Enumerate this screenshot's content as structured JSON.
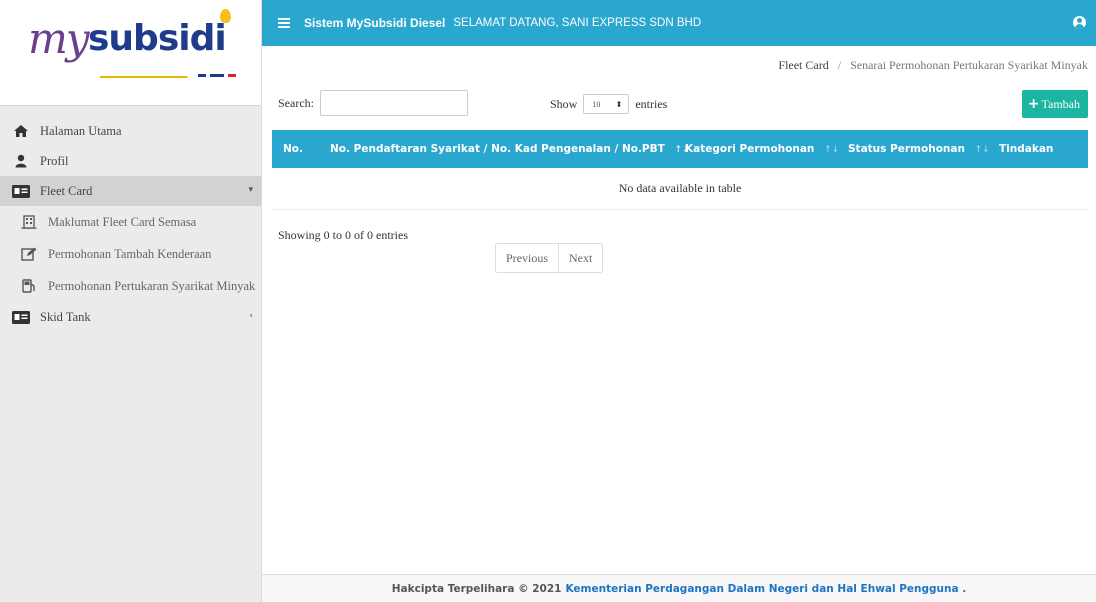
{
  "brand": {
    "logo_my": "my",
    "logo_subsidi": "subsidi"
  },
  "topbar": {
    "system_title": "Sistem MySubsidi Diesel",
    "welcome": "SELAMAT DATANG, SANI EXPRESS SDN BHD"
  },
  "sidebar": {
    "items": [
      {
        "label": "Halaman Utama",
        "icon": "home-icon"
      },
      {
        "label": "Profil",
        "icon": "user-icon"
      },
      {
        "label": "Fleet Card",
        "icon": "id-card-icon",
        "active": true
      },
      {
        "label": "Skid Tank",
        "icon": "id-card-icon"
      }
    ],
    "fleet_sub": [
      {
        "label": "Maklumat Fleet Card Semasa",
        "icon": "building-icon"
      },
      {
        "label": "Permohonan Tambah Kenderaan",
        "icon": "edit-icon"
      },
      {
        "label": "Permohonan Pertukaran Syarikat Minyak",
        "icon": "fuel-pump-icon"
      }
    ]
  },
  "breadcrumb": {
    "parent": "Fleet Card",
    "separator": "/",
    "current": "Senarai Permohonan Pertukaran Syarikat Minyak"
  },
  "table_controls": {
    "search_label": "Search:",
    "search_value": "",
    "show_label": "Show",
    "page_size": "10",
    "entries_label": "entries",
    "add_button": "Tambah"
  },
  "table": {
    "columns": [
      "No.",
      "No. Pendaftaran Syarikat / No. Kad Pengenalan / No.PBT",
      "Kategori Permohonan",
      "Status Permohonan",
      "Tindakan"
    ],
    "empty_text": "No data available in table",
    "info": "Showing 0 to 0 of 0 entries",
    "prev": "Previous",
    "next": "Next"
  },
  "footer": {
    "prefix": "Hakcipta Terpelihara © 2021",
    "org": "Kementerian Perdagangan Dalam Negeri dan Hal Ehwal Pengguna ."
  },
  "colors": {
    "primary": "#2aa7cf",
    "add_button": "#1cb5a0",
    "link": "#1c74c2"
  }
}
